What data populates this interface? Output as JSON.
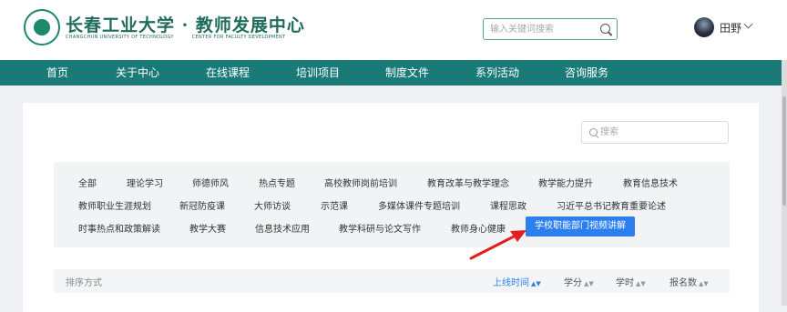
{
  "header": {
    "logo_cn": "长春工业大学 · 教师发展中心",
    "logo_en_left": "CHANGCHUN UNIVERSITY OF TECHNOLOGY",
    "logo_en_right": "CENTER FOR FACULTY DEVELOPMENT",
    "search_placeholder": "输入关键词搜索",
    "user_name": "田野"
  },
  "nav": [
    "首页",
    "关于中心",
    "在线课程",
    "培训项目",
    "制度文件",
    "系列活动",
    "咨询服务"
  ],
  "filter": {
    "search_placeholder": "搜索",
    "categories": [
      [
        "全部",
        "理论学习",
        "师德师风",
        "热点专题",
        "高校教师岗前培训",
        "教育改革与教学理念",
        "教学能力提升",
        "教育信息技术"
      ],
      [
        "教师职业生涯规划",
        "新冠防疫课",
        "大师访谈",
        "示范课",
        "多媒体课件专题培训",
        "课程思政",
        "习近平总书记教育重要论述"
      ],
      [
        "时事热点和政策解读",
        "教学大赛",
        "信息技术应用",
        "教学科研与论文写作",
        "教师身心健康",
        "学校职能部门视频讲解"
      ]
    ],
    "active_category": "学校职能部门视频讲解"
  },
  "sort": {
    "label": "排序方式",
    "options": [
      "上线时间",
      "学分",
      "学时",
      "报名数"
    ],
    "active": "上线时间",
    "arrow_glyph": "▲▼"
  },
  "colors": {
    "nav_bg": "#1a7a78",
    "brand_green": "#1f6b5c",
    "active_blue": "#2d7ff0",
    "annotation_red": "#e02020"
  },
  "icons": {
    "logo": "university-emblem",
    "search": "magnifier-icon",
    "chevron": "chevron-down-icon"
  }
}
